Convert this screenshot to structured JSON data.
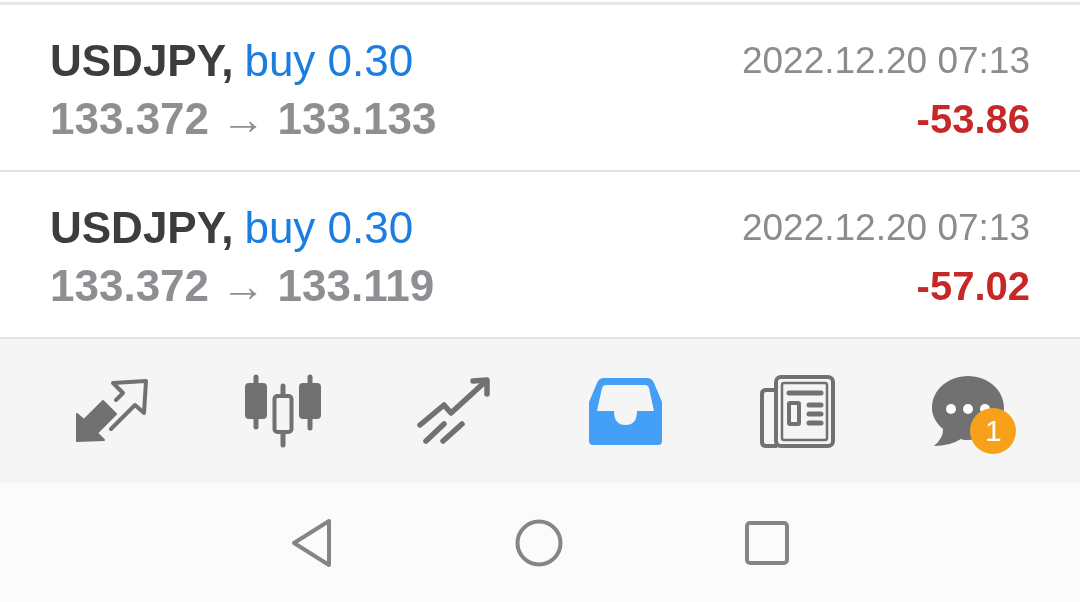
{
  "positions": [
    {
      "symbol": "USDJPY,",
      "order": "buy 0.30",
      "prices": "133.372 → 133.133",
      "time": "2022.12.20 07:13",
      "profit": "-53.86"
    },
    {
      "symbol": "USDJPY,",
      "order": "buy 0.30",
      "prices": "133.372 → 133.119",
      "time": "2022.12.20 07:13",
      "profit": "-57.02"
    }
  ],
  "tab_bar": {
    "tabs": [
      {
        "kind": "arrows",
        "selected": false
      },
      {
        "kind": "candlesticks",
        "selected": false
      },
      {
        "kind": "trend",
        "selected": false
      },
      {
        "kind": "inbox",
        "selected": true
      },
      {
        "kind": "newspaper",
        "selected": false
      },
      {
        "kind": "chat",
        "selected": false,
        "badge": "1"
      }
    ]
  },
  "nav_bar": {
    "buttons": [
      {
        "kind": "back"
      },
      {
        "kind": "home"
      },
      {
        "kind": "recents"
      }
    ]
  }
}
